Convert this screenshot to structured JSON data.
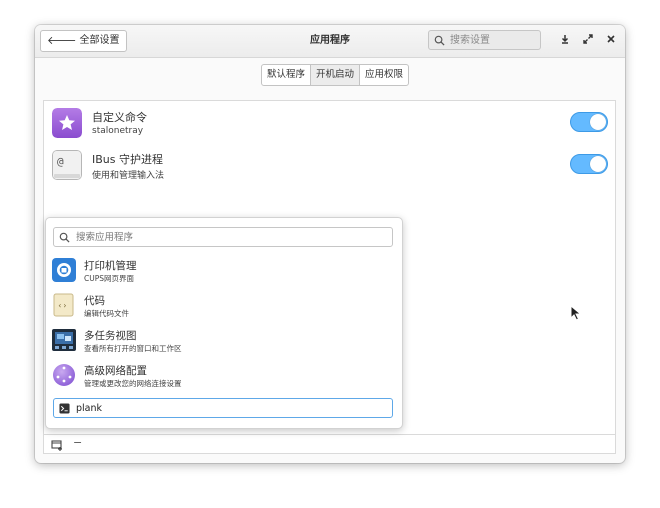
{
  "header": {
    "back_label": "全部设置",
    "title": "应用程序",
    "search_placeholder": "搜索设置"
  },
  "tabs": [
    {
      "label": "默认程序",
      "active": false
    },
    {
      "label": "开机启动",
      "active": true
    },
    {
      "label": "应用权限",
      "active": false
    }
  ],
  "startup_apps": [
    {
      "name": "自定义命令",
      "desc": "stalonetray",
      "enabled": true,
      "icon": "star-icon"
    },
    {
      "name": "IBus 守护进程",
      "desc": "使用和管理输入法",
      "enabled": true,
      "icon": "keyboard-icon"
    }
  ],
  "popover": {
    "search_placeholder": "搜索应用程序",
    "items": [
      {
        "name": "打印机管理",
        "desc": "CUPS网页界面",
        "icon": "printer-icon"
      },
      {
        "name": "代码",
        "desc": "编辑代码文件",
        "icon": "code-icon"
      },
      {
        "name": "多任务视图",
        "desc": "查看所有打开的窗口和工作区",
        "icon": "multitasking-icon"
      },
      {
        "name": "高级网络配置",
        "desc": "管理或更改您的网络连接设置",
        "icon": "network-icon"
      }
    ],
    "command_value": "plank"
  },
  "footer": {
    "remove_label": "−"
  },
  "colors": {
    "accent": "#64baff",
    "toggle_border": "#3d9ae6"
  }
}
